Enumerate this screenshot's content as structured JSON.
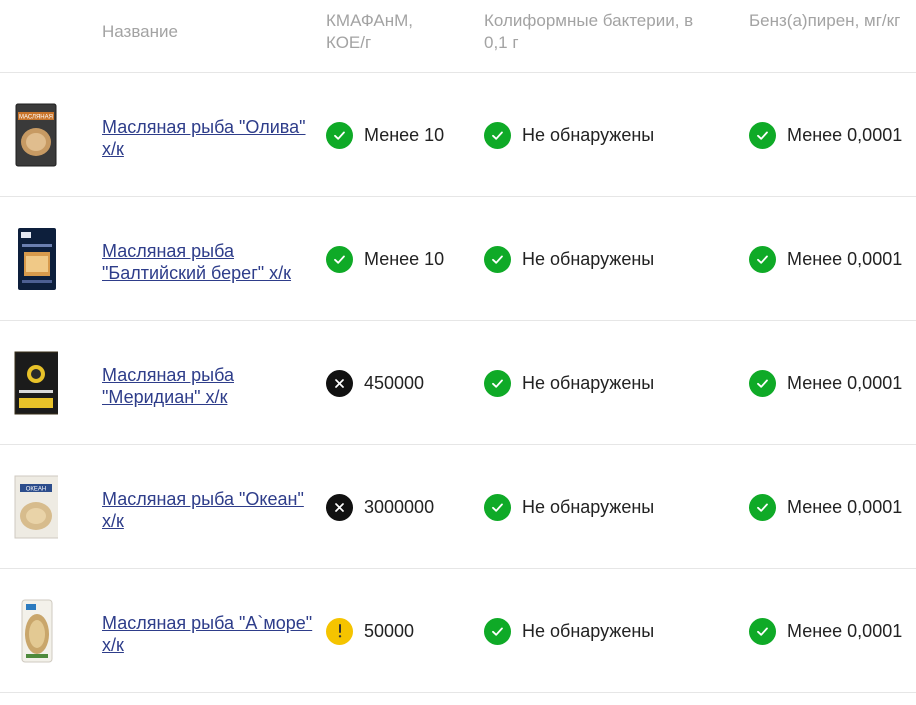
{
  "header": {
    "name": "Название",
    "kmafanm": "КМАФАнМ, КОЕ/г",
    "coliform": "Колиформные бактерии, в 0,1 г",
    "benzapyrene": "Бенз(а)пирен, мг/кг"
  },
  "products": [
    {
      "name": "Масляная рыба \"Олива\" х/к",
      "kmafanm": {
        "value": "Менее 10",
        "status": "ok"
      },
      "coliform": {
        "value": "Не обнаружены",
        "status": "ok"
      },
      "benzapyrene": {
        "value": "Менее 0,0001",
        "status": "ok"
      },
      "thumb_label": "МАСЛЯНАЯ"
    },
    {
      "name": "Масляная рыба \"Балтийский берег\" х/к",
      "kmafanm": {
        "value": "Менее 10",
        "status": "ok"
      },
      "coliform": {
        "value": "Не обнаружены",
        "status": "ok"
      },
      "benzapyrene": {
        "value": "Менее 0,0001",
        "status": "ok"
      },
      "thumb_label": ""
    },
    {
      "name": "Масляная рыба \"Меридиан\" х/к",
      "kmafanm": {
        "value": "450000",
        "status": "bad"
      },
      "coliform": {
        "value": "Не обнаружены",
        "status": "ok"
      },
      "benzapyrene": {
        "value": "Менее 0,0001",
        "status": "ok"
      },
      "thumb_label": ""
    },
    {
      "name": "Масляная рыба \"Океан\" х/к",
      "kmafanm": {
        "value": "3000000",
        "status": "bad"
      },
      "coliform": {
        "value": "Не обнаружены",
        "status": "ok"
      },
      "benzapyrene": {
        "value": "Менее 0,0001",
        "status": "ok"
      },
      "thumb_label": "ОКЕАН"
    },
    {
      "name": "Масляная рыба \"А`море\" х/к",
      "kmafanm": {
        "value": "50000",
        "status": "warn"
      },
      "coliform": {
        "value": "Не обнаружены",
        "status": "ok"
      },
      "benzapyrene": {
        "value": "Менее 0,0001",
        "status": "ok"
      },
      "thumb_label": ""
    }
  ],
  "colors": {
    "ok": "#0faa27",
    "bad": "#111111",
    "warn": "#f5c400",
    "link": "#2e3d8a",
    "header_text": "#a3a3a3"
  },
  "icons": {
    "ok": "check-icon",
    "bad": "cross-icon",
    "warn": "exclamation-icon"
  }
}
